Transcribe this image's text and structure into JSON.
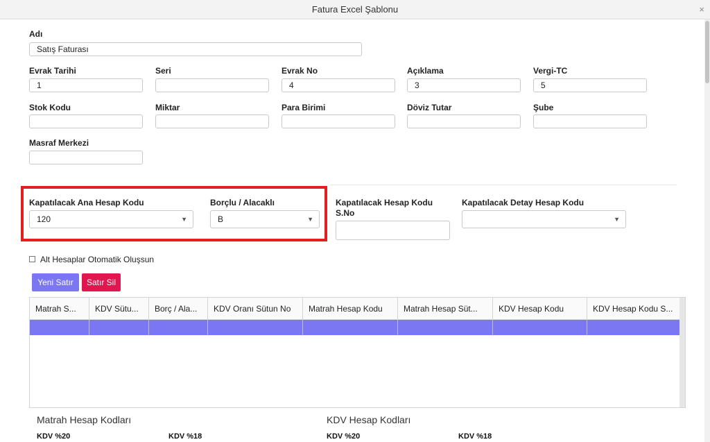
{
  "window": {
    "title": "Fatura Excel Şablonu",
    "close_label": "×"
  },
  "form": {
    "adi": {
      "label": "Adı",
      "value": "Satış Faturası"
    },
    "evrak_tarihi": {
      "label": "Evrak Tarihi",
      "value": "1"
    },
    "seri": {
      "label": "Seri",
      "value": ""
    },
    "evrak_no": {
      "label": "Evrak No",
      "value": "4"
    },
    "aciklama": {
      "label": "Açıklama",
      "value": "3"
    },
    "vergi_tc": {
      "label": "Vergi-TC",
      "value": "5"
    },
    "stok_kodu": {
      "label": "Stok Kodu",
      "value": ""
    },
    "miktar": {
      "label": "Miktar",
      "value": ""
    },
    "para_birimi": {
      "label": "Para Birimi",
      "value": ""
    },
    "doviz_tutar": {
      "label": "Döviz Tutar",
      "value": ""
    },
    "sube": {
      "label": "Şube",
      "value": ""
    },
    "masraf_merkezi": {
      "label": "Masraf Merkezi",
      "value": ""
    }
  },
  "closing": {
    "ana_hesap": {
      "label": "Kapatılacak Ana Hesap Kodu",
      "value": "120"
    },
    "borclu_alacakli": {
      "label": "Borçlu / Alacaklı",
      "value": "B"
    },
    "hesap_sno": {
      "label_line1": "Kapatılacak Hesap Kodu",
      "label_line2": "S.No",
      "value": ""
    },
    "detay_hesap": {
      "label": "Kapatılacak Detay Hesap Kodu",
      "value": ""
    },
    "arrow": "▼"
  },
  "checkbox": {
    "label": "Alt Hesaplar Otomatik Oluşsun",
    "checked": false
  },
  "buttons": {
    "new_row": "Yeni Satır",
    "delete_row": "Satır Sil",
    "new_row_color": "#7b77f3",
    "delete_row_color": "#e0174f"
  },
  "grid": {
    "columns": [
      "Matrah S...",
      "KDV Sütu...",
      "Borç / Ala...",
      "KDV Oranı Sütun No",
      "Matrah Hesap Kodu",
      "Matrah Hesap Süt...",
      "KDV Hesap Kodu",
      "KDV Hesap Kodu S..."
    ],
    "selected_row_color": "#7b77f3"
  },
  "sections": {
    "matrah_title": "Matrah Hesap Kodları",
    "kdv_title": "KDV Hesap Kodları",
    "matrah_items": [
      "KDV %20",
      "KDV %18"
    ],
    "kdv_items": [
      "KDV %20",
      "KDV %18"
    ]
  }
}
